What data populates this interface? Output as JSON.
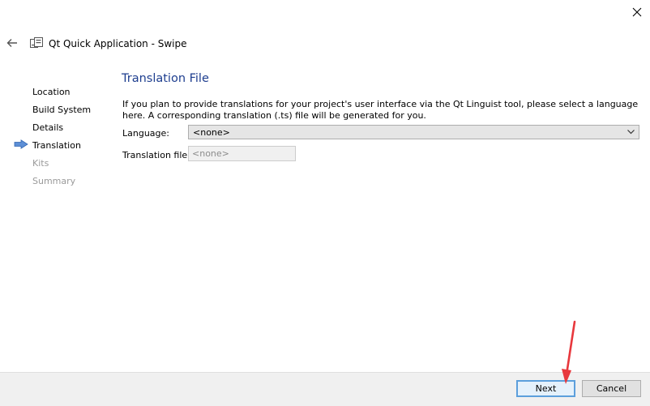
{
  "window": {
    "title": "Qt Quick Application - Swipe",
    "close_icon": "close-icon",
    "back_icon": "back-arrow-icon",
    "app_icon": "qt-wizard-icon"
  },
  "sidebar": {
    "items": [
      {
        "label": "Location",
        "state": "done"
      },
      {
        "label": "Build System",
        "state": "done"
      },
      {
        "label": "Details",
        "state": "done"
      },
      {
        "label": "Translation",
        "state": "current"
      },
      {
        "label": "Kits",
        "state": "pending"
      },
      {
        "label": "Summary",
        "state": "pending"
      }
    ],
    "current_marker_icon": "arrow-right-icon"
  },
  "page": {
    "title": "Translation File",
    "description": "If you plan to provide translations for your project's user interface via the Qt Linguist tool, please select a language here. A corresponding translation (.ts) file will be generated for you.",
    "language_label": "Language:",
    "language_value": "<none>",
    "translation_file_label": "Translation file:",
    "translation_file_value": "<none>"
  },
  "footer": {
    "next_label": "Next",
    "cancel_label": "Cancel"
  },
  "colors": {
    "title_blue": "#1e3e8f",
    "annotation_arrow": "#e8383d",
    "focus_border": "#5c9fdc"
  }
}
